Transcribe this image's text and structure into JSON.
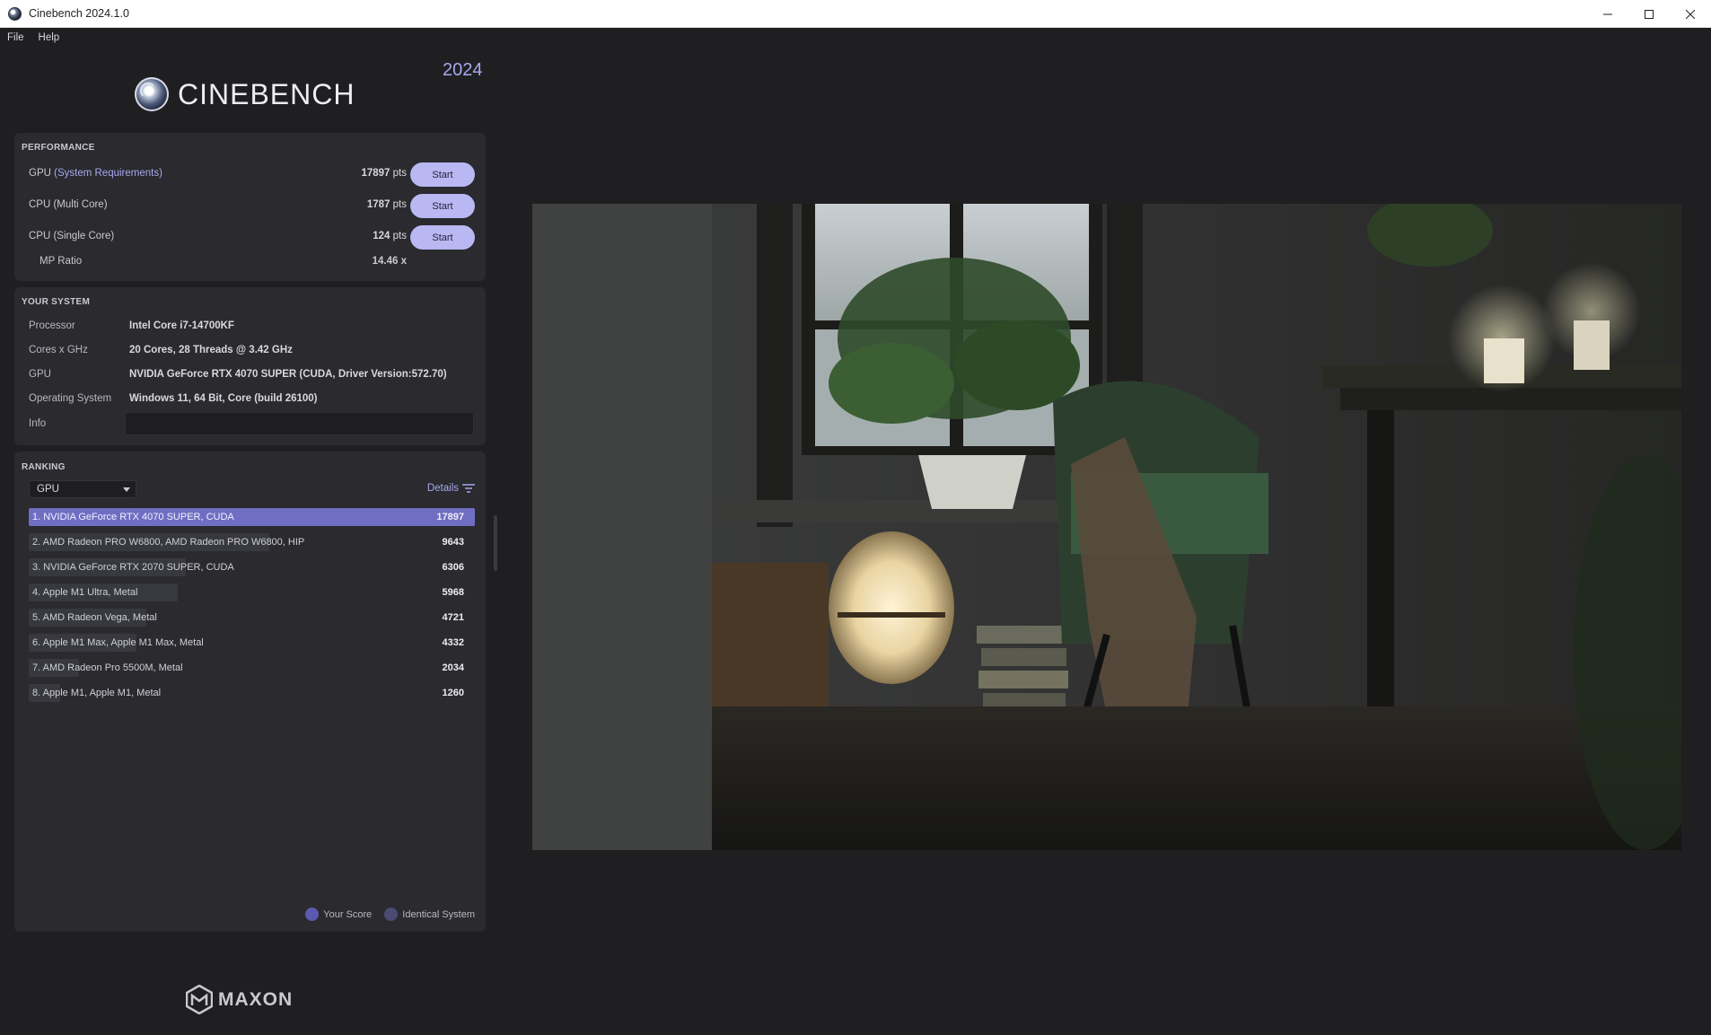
{
  "window": {
    "title": "Cinebench 2024.1.0"
  },
  "menu": {
    "items": [
      "File",
      "Help"
    ]
  },
  "brand": {
    "logo_text": "CINEBENCH",
    "year": "2024",
    "footer_logo": "MAXON"
  },
  "performance": {
    "heading": "PERFORMANCE",
    "rows": [
      {
        "label": "GPU",
        "label_link": "(System Requirements)",
        "score": "17897",
        "unit": "pts",
        "button": "Start"
      },
      {
        "label": "CPU (Multi Core)",
        "score": "1787",
        "unit": "pts",
        "button": "Start"
      },
      {
        "label": "CPU (Single Core)",
        "score": "124",
        "unit": "pts",
        "button": "Start"
      }
    ],
    "mp_ratio": {
      "label": "MP Ratio",
      "value": "14.46 x"
    }
  },
  "system": {
    "heading": "YOUR SYSTEM",
    "rows": [
      {
        "key": "Processor",
        "value": "Intel Core i7-14700KF"
      },
      {
        "key": "Cores x GHz",
        "value": "20 Cores, 28 Threads @ 3.42 GHz"
      },
      {
        "key": "GPU",
        "value": "NVIDIA GeForce RTX 4070 SUPER (CUDA, Driver Version:572.70)"
      },
      {
        "key": "Operating System",
        "value": "Windows 11, 64 Bit, Core (build 26100)"
      },
      {
        "key": "Info",
        "value": ""
      }
    ]
  },
  "ranking": {
    "heading": "RANKING",
    "selected": "GPU",
    "details_label": "Details",
    "items": [
      {
        "name": "1. NVIDIA GeForce RTX 4070 SUPER, CUDA",
        "score": 17897,
        "is_you": true
      },
      {
        "name": "2. AMD Radeon PRO W6800, AMD Radeon PRO W6800, HIP",
        "score": 9643,
        "is_you": false
      },
      {
        "name": "3. NVIDIA GeForce RTX 2070 SUPER, CUDA",
        "score": 6306,
        "is_you": false
      },
      {
        "name": "4. Apple M1 Ultra, Metal",
        "score": 5968,
        "is_you": false
      },
      {
        "name": "5. AMD Radeon Vega, Metal",
        "score": 4721,
        "is_you": false
      },
      {
        "name": "6. Apple M1 Max, Apple M1 Max, Metal",
        "score": 4332,
        "is_you": false
      },
      {
        "name": "7. AMD Radeon Pro 5500M, Metal",
        "score": 2034,
        "is_you": false
      },
      {
        "name": "8. Apple M1, Apple M1, Metal",
        "score": 1260,
        "is_you": false
      }
    ],
    "legend": [
      {
        "label": "Your Score",
        "color": "#5b5ab0"
      },
      {
        "label": "Identical System",
        "color": "#4a4a72"
      }
    ]
  },
  "colors": {
    "accent": "#b9b8f3",
    "your_score_bar": "#6f6ec3",
    "bar": "#38383f",
    "background": "#1f1f22",
    "panel": "#2a2a2f"
  }
}
